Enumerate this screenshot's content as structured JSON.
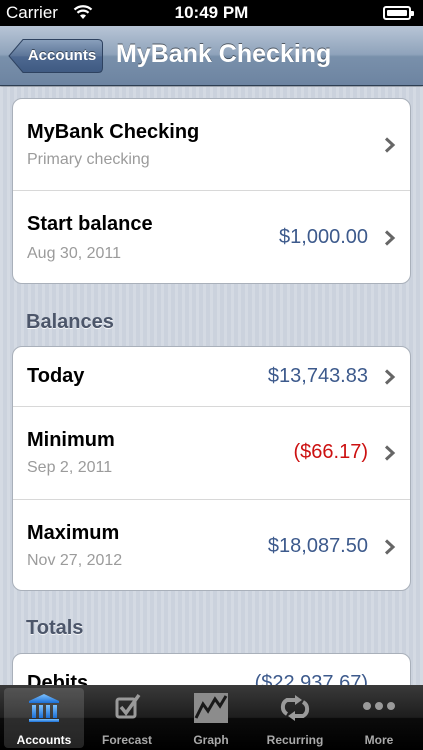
{
  "status_bar": {
    "carrier": "Carrier",
    "time": "10:49 PM"
  },
  "nav": {
    "back_label": "Accounts",
    "title": "MyBank Checking"
  },
  "account_group": {
    "name": {
      "title": "MyBank Checking",
      "subtitle": "Primary checking"
    },
    "start_balance": {
      "title": "Start balance",
      "subtitle": "Aug 30, 2011",
      "value": "$1,000.00"
    }
  },
  "balances": {
    "header": "Balances",
    "today": {
      "title": "Today",
      "value": "$13,743.83"
    },
    "minimum": {
      "title": "Minimum",
      "subtitle": "Sep 2, 2011",
      "value": "($66.17)"
    },
    "maximum": {
      "title": "Maximum",
      "subtitle": "Nov 27, 2012",
      "value": "$18,087.50"
    }
  },
  "totals": {
    "header": "Totals",
    "debits": {
      "title": "Debits",
      "value": "($22,937.67)"
    }
  },
  "colors": {
    "value_blue": "#3d5a8c",
    "negative_red": "#cc1111"
  },
  "tabs": [
    {
      "label": "Accounts",
      "icon": "bank-icon",
      "active": true
    },
    {
      "label": "Forecast",
      "icon": "checkbox-icon",
      "active": false
    },
    {
      "label": "Graph",
      "icon": "graph-icon",
      "active": false
    },
    {
      "label": "Recurring",
      "icon": "recurring-icon",
      "active": false
    },
    {
      "label": "More",
      "icon": "more-icon",
      "active": false
    }
  ]
}
